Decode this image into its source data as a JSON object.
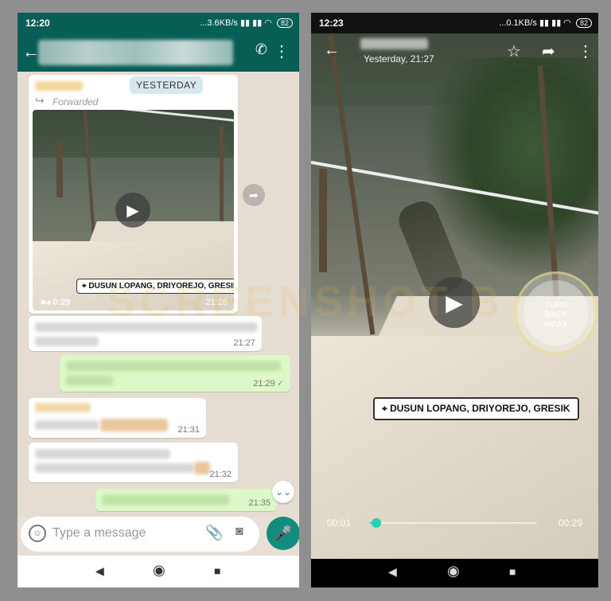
{
  "left_phone": {
    "status": {
      "time": "12:20",
      "network": "...3.6KB/s",
      "battery": "82"
    },
    "header": {
      "back_icon": "arrow-left",
      "add_call_icon": "phone-plus",
      "menu_icon": "more-vert"
    },
    "date_pill": "YESTERDAY",
    "forwarded_label": "Forwarded",
    "video_message": {
      "duration": "0:29",
      "time": "21:26",
      "location_label": "DUSUN LOPANG, DRIYOREJO, GRESIK"
    },
    "messages": [
      {
        "direction": "in",
        "time": "21:27"
      },
      {
        "direction": "out",
        "time": "21:29"
      },
      {
        "direction": "in",
        "time": "21:31"
      },
      {
        "direction": "in",
        "time": "21:32"
      },
      {
        "direction": "out",
        "time": "21:35"
      }
    ],
    "composer": {
      "placeholder": "Type a message"
    },
    "nav": {
      "back": "◀",
      "home": "◉",
      "recents": "■"
    }
  },
  "right_phone": {
    "status": {
      "time": "12:23",
      "network": "...0.1KB/s",
      "battery": "82"
    },
    "header": {
      "subtitle": "Yesterday, 21:27"
    },
    "location_label": "DUSUN LOPANG, DRIYOREJO, GRESIK",
    "stamp_text": [
      "TURN",
      "BACK",
      "HOAX"
    ],
    "player": {
      "current": "00:01",
      "duration": "00:29",
      "progress": 0.04
    },
    "nav": {
      "back": "◀",
      "home": "◉",
      "recents": "■"
    }
  },
  "overlay_watermark": "SCREENSHOT B"
}
